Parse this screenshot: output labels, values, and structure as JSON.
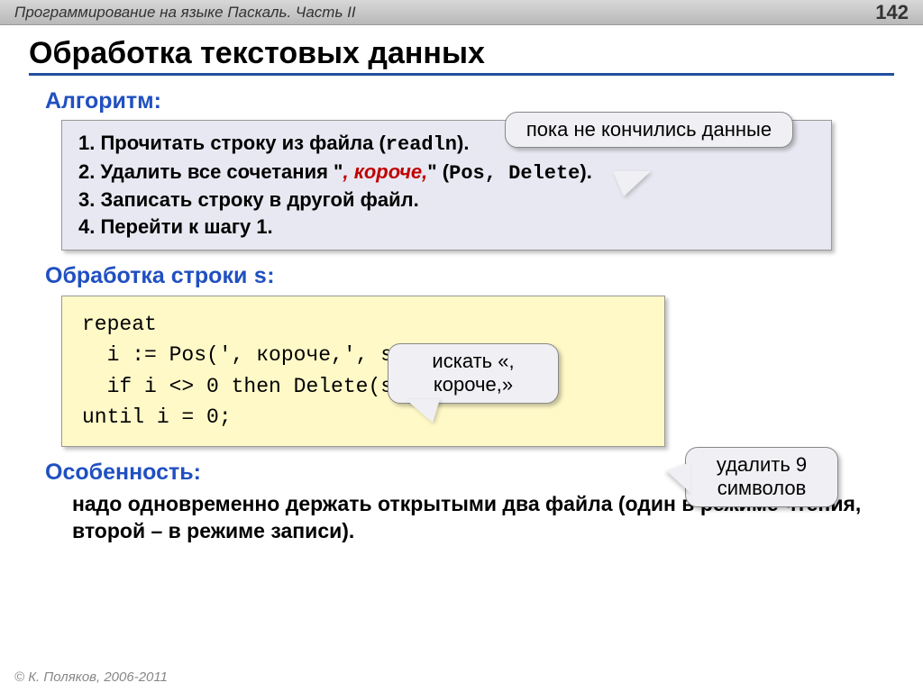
{
  "header": {
    "left": "Программирование на языке Паскаль. Часть II",
    "page_num": "142"
  },
  "title": "Обработка текстовых данных",
  "callouts": {
    "data_not_ended": "пока не кончились данные",
    "search_phrase": "искать «, короче,»",
    "delete_9": "удалить 9 символов"
  },
  "algorithm": {
    "heading": "Алгоритм:",
    "step1_a": "1. Прочитать строку из файла (",
    "step1_b": "readln",
    "step1_c": ").",
    "step2_a": "2. Удалить все сочетания \"",
    "step2_b": ", короче,",
    "step2_c": "\" (",
    "step2_d": "Pos",
    "step2_e": ", ",
    "step2_f": "Delete",
    "step2_g": ").",
    "step3": "3. Записать строку в другой файл.",
    "step4": "4. Перейти к шагу 1."
  },
  "processing": {
    "heading_a": "Обработка строки ",
    "heading_b": "s",
    "heading_c": ":",
    "code": "repeat\n  i := Pos(', короче,', s);\n  if i <> 0 then Delete(s, i, 9);\nuntil i = 0;"
  },
  "feature": {
    "heading": "Особенность:",
    "text": "надо одновременно держать открытыми два файла (один в режиме чтения, второй – в режиме записи)."
  },
  "footer": "© К. Поляков, 2006-2011"
}
